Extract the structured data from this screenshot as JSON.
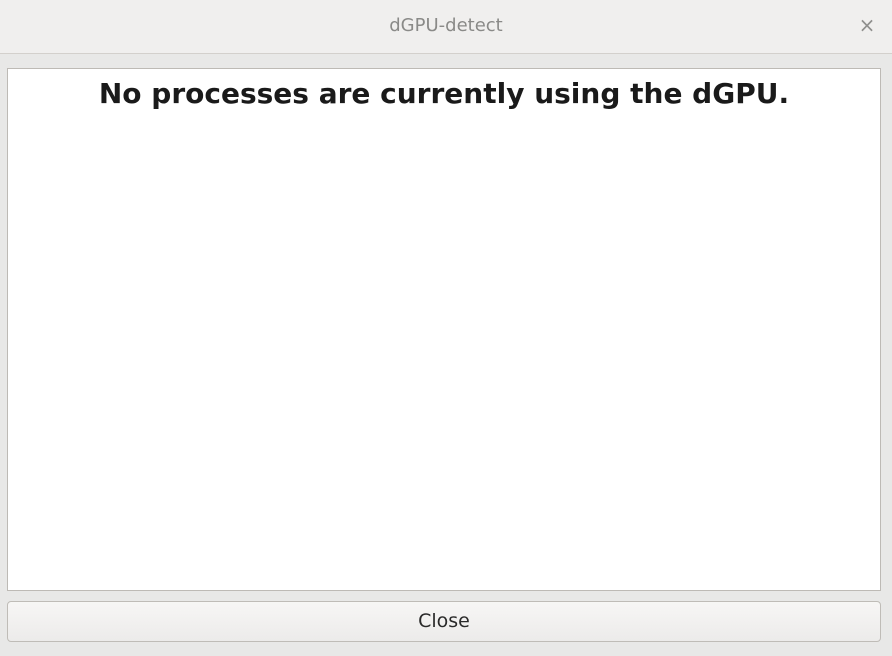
{
  "window": {
    "title": "dGPU-detect",
    "close_glyph": "×"
  },
  "content": {
    "message": "No processes are currently using the dGPU."
  },
  "footer": {
    "close_label": "Close"
  },
  "colors": {
    "titlebar_bg": "#f0efee",
    "window_bg": "#e8e8e7",
    "content_bg": "#ffffff",
    "title_text": "#8a8a88",
    "message_text": "#1a1a1a"
  }
}
